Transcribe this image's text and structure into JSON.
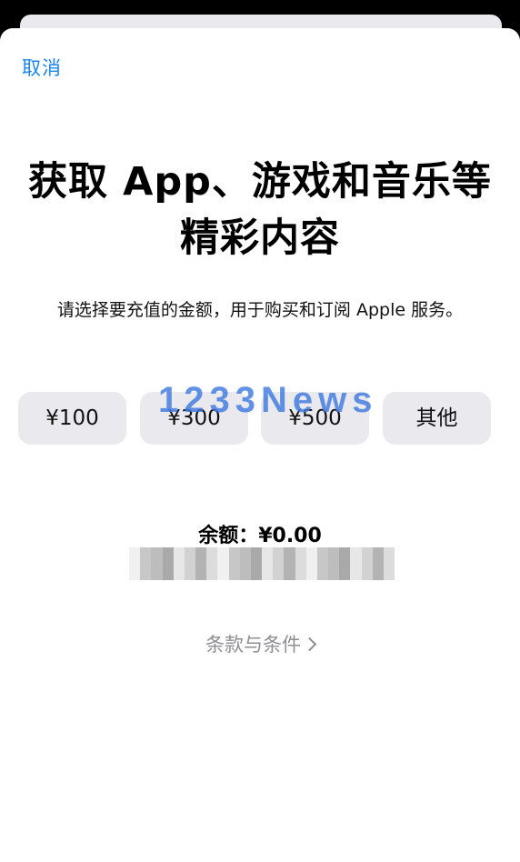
{
  "header": {
    "cancel_label": "取消"
  },
  "main": {
    "title": "获取 App、游戏和音乐等精彩内容",
    "subtitle": "请选择要充值的金额，用于购买和订阅 Apple 服务。",
    "amounts": [
      {
        "label": "¥100"
      },
      {
        "label": "¥300"
      },
      {
        "label": "¥500"
      },
      {
        "label": "其他"
      }
    ],
    "balance": "余额：¥0.00",
    "terms_label": "条款与条件"
  },
  "overlay": {
    "watermark": "1233News"
  },
  "colors": {
    "accent": "#1a84f0",
    "button_bg": "#e9e9ee",
    "muted_text": "#8e8e93",
    "watermark": "#3f7be0"
  },
  "icons": {
    "terms_chevron": "chevron-right-icon"
  }
}
